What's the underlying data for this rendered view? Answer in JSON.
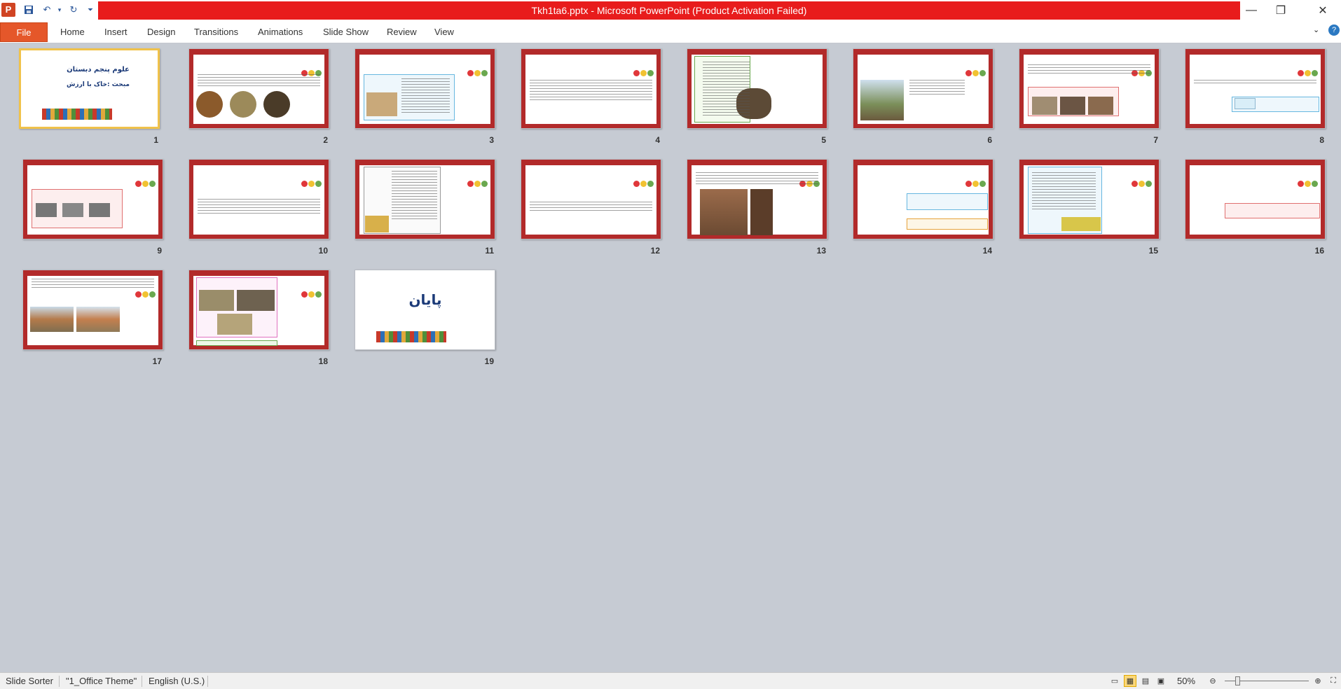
{
  "window": {
    "title": "Tkh1ta6.pptx  -  Microsoft PowerPoint (Product Activation Failed)",
    "app_icon_letter": "P",
    "controls": {
      "minimize": "—",
      "restore": "❐",
      "close": "✕"
    }
  },
  "ribbon": {
    "file_label": "File",
    "tabs": [
      "Home",
      "Insert",
      "Design",
      "Transitions",
      "Animations",
      "Slide Show",
      "Review",
      "View"
    ]
  },
  "slides": [
    {
      "number": "1",
      "title": "علوم پنجم دبستان",
      "subtitle": "مبحث :خاک با ارزش"
    },
    {
      "number": "2"
    },
    {
      "number": "3"
    },
    {
      "number": "4"
    },
    {
      "number": "5"
    },
    {
      "number": "6"
    },
    {
      "number": "7"
    },
    {
      "number": "8"
    },
    {
      "number": "9"
    },
    {
      "number": "10"
    },
    {
      "number": "11"
    },
    {
      "number": "12"
    },
    {
      "number": "13"
    },
    {
      "number": "14"
    },
    {
      "number": "15"
    },
    {
      "number": "16"
    },
    {
      "number": "17"
    },
    {
      "number": "18"
    },
    {
      "number": "19",
      "title": "پایان"
    }
  ],
  "status": {
    "view": "Slide Sorter",
    "theme": "\"1_Office Theme\"",
    "language": "English (U.S.)",
    "zoom": "50%",
    "zoom_level_percent": 50
  },
  "colors": {
    "title_bar_red": "#e81c1c",
    "file_tab": "#e5572a",
    "slide_frame": "#b22a2a",
    "selected_border": "#f0c24b",
    "background": "#c6cbd3"
  }
}
